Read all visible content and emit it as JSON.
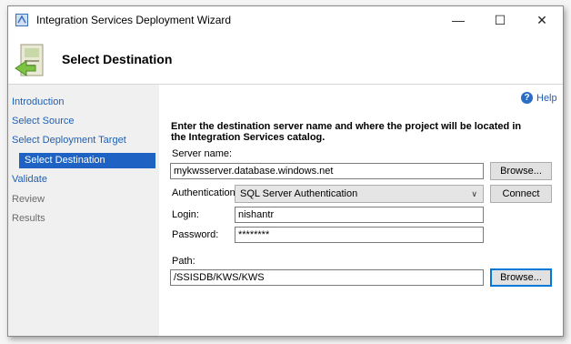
{
  "window": {
    "title": "Integration Services Deployment Wizard",
    "controls": {
      "minimize": "—",
      "maximize": "☐",
      "close": "✕"
    }
  },
  "header": {
    "title": "Select Destination"
  },
  "nav": {
    "items": [
      {
        "label": "Introduction",
        "state": "link"
      },
      {
        "label": "Select Source",
        "state": "link"
      },
      {
        "label": "Select Deployment Target",
        "state": "link"
      },
      {
        "label": "Select Destination",
        "state": "selected"
      },
      {
        "label": "Validate",
        "state": "link"
      },
      {
        "label": "Review",
        "state": "disabled"
      },
      {
        "label": "Results",
        "state": "disabled"
      }
    ]
  },
  "help": {
    "label": "Help"
  },
  "form": {
    "instructions": "Enter the destination server name and where the project will be located in the Integration Services catalog.",
    "server_name_label": "Server name:",
    "server_name_value": "mykwsserver.database.windows.net",
    "browse_server_label": "Browse...",
    "authentication_label": "Authentication:",
    "authentication_value": "SQL Server Authentication",
    "connect_label": "Connect",
    "login_label": "Login:",
    "login_value": "nishantr",
    "password_label": "Password:",
    "password_value": "********",
    "path_label": "Path:",
    "path_value": "/SSISDB/KWS/KWS",
    "browse_path_label": "Browse..."
  },
  "colors": {
    "accent": "#1e63c4",
    "link": "#1f5fb3",
    "disabled": "#6d6d6d"
  }
}
